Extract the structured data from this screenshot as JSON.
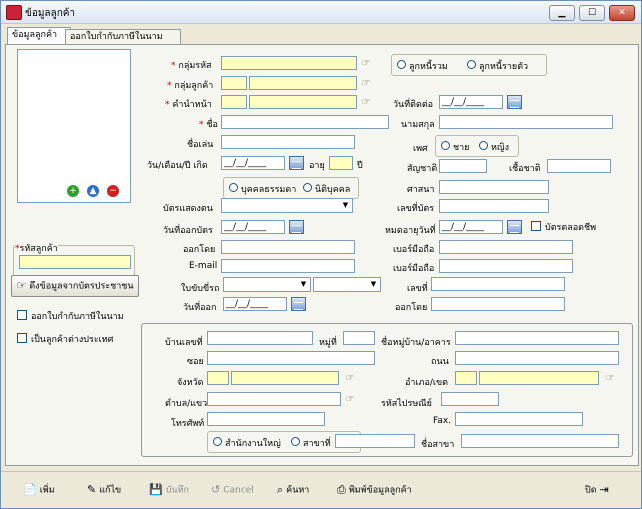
{
  "window": {
    "title": "ข้อมูลลูกค้า",
    "min_label": "▁",
    "max_label": "☐",
    "close_label": "✕"
  },
  "tabs": [
    "ข้อมูลลูกค้า",
    "ออกใบกำกับภาษีในนาม"
  ],
  "sidebar": {
    "code_label": "รหัสลูกค้า",
    "read_card_button": "ดึงข้อมูลจากบัตรประชาชน",
    "chk_tax_invoice": "ออกใบกำกับภาษีในนาม",
    "chk_foreign": "เป็นลูกค้าต่างประเทศ"
  },
  "form": {
    "group_code": "กลุ่มรหัส",
    "customer_group": "กลุ่มลูกค้า",
    "prefix": "คำนำหน้า",
    "name": "ชื่อ",
    "nickname": "ชื่อเล่น",
    "dob": "วัน/เดือน/ปี เกิด",
    "age": "อายุ",
    "year_unit": "ปี",
    "contact_date": "วันที่ติดต่อ",
    "surname": "นามสกุล",
    "sex": "เพศ",
    "male": "ชาย",
    "female": "หญิง",
    "nationality": "สัญชาติ",
    "race": "เชื้อชาติ",
    "religion": "ศาสนา",
    "person_normal": "บุคคลธรรมดา",
    "juristic": "นิติบุคคล",
    "id_card_type": "บัตรแสดงตน",
    "card_no": "เลขที่บัตร",
    "issue_date": "วันที่ออกบัตร",
    "expire_date": "หมดอายุวันที่",
    "lifetime_card": "บัตรตลอดชีพ",
    "issued_by": "ออกโดย",
    "mobile": "เบอร์มือถือ",
    "email": "E-mail",
    "mobile2": "เบอร์มือถือ",
    "license": "ใบขับขี่รถ",
    "license_no": "เลขที่",
    "license_issue": "วันที่ออก",
    "license_by": "ออกโดย",
    "debtor_all": "ลูกหนี้รวม",
    "debtor_each": "ลูกหนี้รายตัว",
    "date_mask": "__/__/____"
  },
  "address": {
    "house_no": "บ้านเลขที่",
    "moo": "หมู่ที่",
    "village": "ชื่อหมู่บ้าน/อาคาร",
    "soi": "ซอย",
    "road": "ถนน",
    "province": "จังหวัด",
    "district": "อำเภอ/เขต",
    "subdistrict": "ตำบล/แขวง",
    "postcode": "รหัสไปรษณีย์",
    "phone": "โทรศัพท์",
    "fax": "Fax.",
    "head_office": "สำนักงานใหญ่",
    "branch": "สาขาที่",
    "branch_name": "ชื่อสาขา"
  },
  "toolbar": {
    "add": "เพิ่ม",
    "edit": "แก้ไข",
    "save": "บันทึก",
    "cancel": "Cancel",
    "search": "ค้นหา",
    "print": "พิมพ์ข้อมูลลูกค้า",
    "close": "ปิด"
  },
  "colors": {
    "required": "#d00000",
    "yellow_field": "#ffffc0"
  }
}
